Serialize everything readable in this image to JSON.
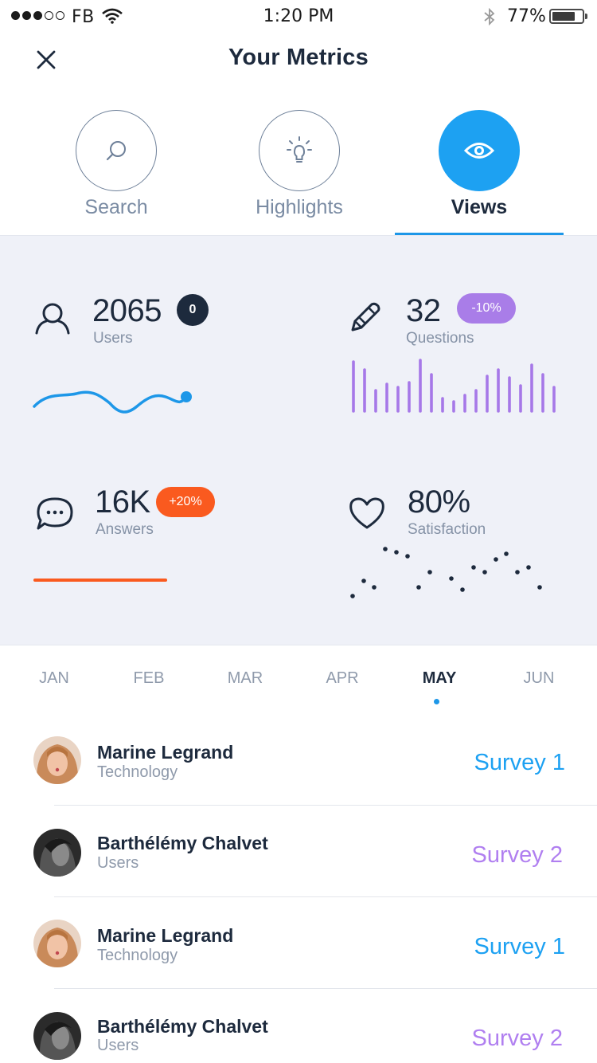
{
  "status_bar": {
    "carrier": "FB",
    "time": "1:20 PM",
    "battery": "77%",
    "battery_level": 0.77
  },
  "header": {
    "title": "Your Metrics",
    "close_icon": "close-icon"
  },
  "tabs": [
    {
      "label": "Search",
      "icon": "search-icon",
      "active": false
    },
    {
      "label": "Highlights",
      "icon": "lightbulb-icon",
      "active": false
    },
    {
      "label": "Views",
      "icon": "eye-icon",
      "active": true
    }
  ],
  "metrics": {
    "users": {
      "value": "2065",
      "label": "Users",
      "badge": "0",
      "icon": "user-icon"
    },
    "questions": {
      "value": "32",
      "label": "Questions",
      "badge": "-10%",
      "icon": "pencil-icon"
    },
    "answers": {
      "value": "16K",
      "label": "Answers",
      "badge": "+20%",
      "icon": "chat-bubble-icon"
    },
    "satisfaction": {
      "value": "80%",
      "label": "Satisfaction",
      "icon": "heart-icon"
    }
  },
  "colors": {
    "accent": "#1da1f2",
    "purple": "#a678e8",
    "orange": "#fa5a1f",
    "dark": "#1d2a3d"
  },
  "months": [
    {
      "label": "JAN",
      "active": false
    },
    {
      "label": "FEB",
      "active": false
    },
    {
      "label": "MAR",
      "active": false
    },
    {
      "label": "APR",
      "active": false
    },
    {
      "label": "MAY",
      "active": true
    },
    {
      "label": "JUN",
      "active": false
    }
  ],
  "list": [
    {
      "name": "Marine Legrand",
      "subtitle": "Technology",
      "survey": "Survey 1",
      "survey_color": "#1da1f2"
    },
    {
      "name": "Barthélémy Chalvet",
      "subtitle": "Users",
      "survey": "Survey 2",
      "survey_color": "#b07ff0"
    },
    {
      "name": "Marine Legrand",
      "subtitle": "Technology",
      "survey": "Survey 1",
      "survey_color": "#1da1f2"
    },
    {
      "name": "Barthélémy Chalvet",
      "subtitle": "Users",
      "survey": "Survey 2",
      "survey_color": "#b07ff0"
    }
  ]
}
